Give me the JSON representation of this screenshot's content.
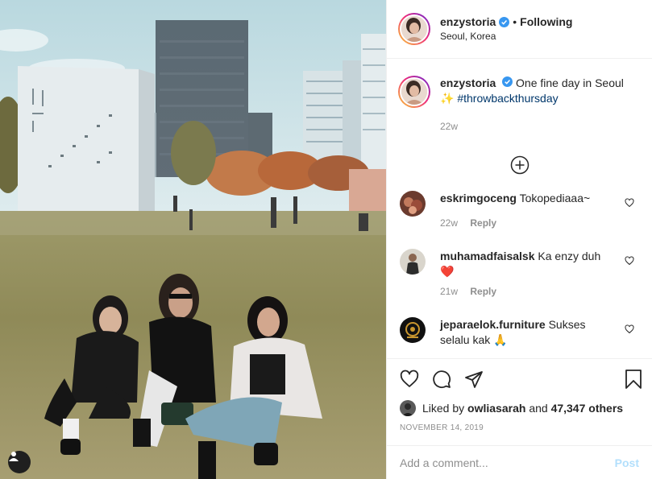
{
  "colors": {
    "link": "#00376b",
    "verified": "#3897f0",
    "muted": "#8e8e8e",
    "post_disabled": "#b2dffc",
    "heart": "#ed4956"
  },
  "photo": {
    "tag_icon": "user-tag-icon"
  },
  "header": {
    "username": "enzystoria",
    "dot": "•",
    "following": "Following",
    "location": "Seoul, Korea"
  },
  "caption": {
    "username": "enzystoria",
    "text": "One fine day in Seoul",
    "emoji": "✨",
    "hashtag": "#throwbackthursday",
    "age": "22w"
  },
  "comments": [
    {
      "username": "eskrimgoceng",
      "text": "Tokopediaaa~",
      "age": "22w",
      "reply": "Reply"
    },
    {
      "username": "muhamadfaisalsk",
      "text": "Ka enzy duh",
      "emoji": "❤️",
      "age": "21w",
      "reply": "Reply"
    },
    {
      "username": "jeparaelok.furniture",
      "text": "Sukses selalu kak",
      "emoji": "🙏"
    }
  ],
  "likes": {
    "prefix": "Liked by",
    "user": "owliasarah",
    "and": "and",
    "count": "47,347 others"
  },
  "date": "NOVEMBER 14, 2019",
  "composer": {
    "placeholder": "Add a comment...",
    "post": "Post"
  }
}
